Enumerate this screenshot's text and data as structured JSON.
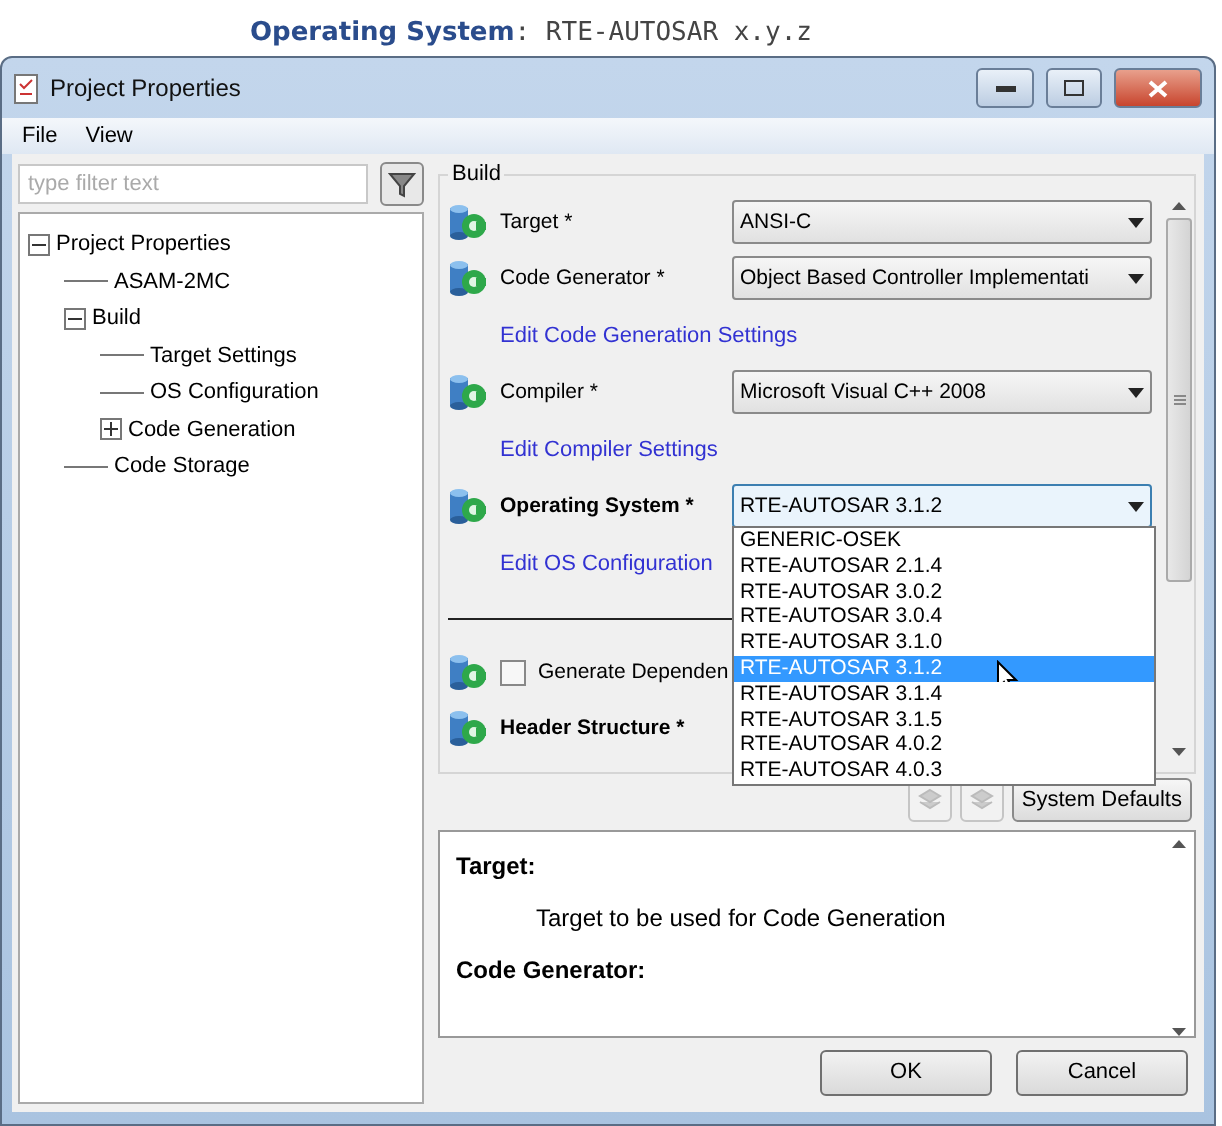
{
  "caption": {
    "label": "Operating System",
    "value": ": RTE-AUTOSAR x.y.z"
  },
  "window": {
    "title": "Project Properties"
  },
  "menu": [
    "File",
    "View"
  ],
  "filter": {
    "placeholder": "type filter text"
  },
  "tree": [
    {
      "label": "Project Properties",
      "expanded": true,
      "children": [
        {
          "label": "ASAM-2MC"
        },
        {
          "label": "Build",
          "expanded": true,
          "children": [
            {
              "label": "Target Settings"
            },
            {
              "label": "OS Configuration"
            },
            {
              "label": "Code Generation",
              "expanded": false
            }
          ]
        },
        {
          "label": "Code Storage"
        }
      ]
    }
  ],
  "build": {
    "title": "Build",
    "fields": [
      {
        "kind": "combo",
        "label": "Target *",
        "value": "ANSI-C",
        "bold": false
      },
      {
        "kind": "combo",
        "label": "Code Generator *",
        "value": "Object Based Controller Implementati",
        "bold": false
      },
      {
        "kind": "link",
        "label": "Edit Code Generation Settings"
      },
      {
        "kind": "combo",
        "label": "Compiler *",
        "value": "Microsoft Visual C++ 2008",
        "bold": false
      },
      {
        "kind": "link",
        "label": "Edit Compiler Settings"
      },
      {
        "kind": "combo",
        "label": "Operating System *",
        "value": "RTE-AUTOSAR 3.1.2",
        "bold": true,
        "open": true,
        "options": [
          {
            "label": "GENERIC-OSEK",
            "selected": false
          },
          {
            "label": "RTE-AUTOSAR 2.1.4",
            "selected": false
          },
          {
            "label": "RTE-AUTOSAR 3.0.2",
            "selected": false
          },
          {
            "label": "RTE-AUTOSAR 3.0.4",
            "selected": false
          },
          {
            "label": "RTE-AUTOSAR 3.1.0",
            "selected": false
          },
          {
            "label": "RTE-AUTOSAR 3.1.2",
            "selected": true
          },
          {
            "label": "RTE-AUTOSAR 3.1.4",
            "selected": false
          },
          {
            "label": "RTE-AUTOSAR 3.1.5",
            "selected": false
          },
          {
            "label": "RTE-AUTOSAR 4.0.2",
            "selected": false
          },
          {
            "label": "RTE-AUTOSAR 4.0.3",
            "selected": false
          }
        ]
      },
      {
        "kind": "link",
        "label": "Edit OS Configuration"
      },
      {
        "kind": "separator"
      },
      {
        "kind": "checkbox",
        "label": "Generate Dependen",
        "checked": false
      },
      {
        "kind": "heading",
        "label": "Header Structure *",
        "bold": true
      }
    ]
  },
  "toolbar": {
    "buttons": [
      {
        "kind": "icon",
        "disabled": true
      },
      {
        "kind": "icon",
        "disabled": true
      },
      {
        "kind": "text",
        "label": "System Defaults",
        "disabled": false
      }
    ]
  },
  "help": [
    {
      "kind": "heading",
      "text": "Target:"
    },
    {
      "kind": "body",
      "text": "Target to be used for Code Generation"
    },
    {
      "kind": "heading",
      "text": "Code Generator:"
    }
  ],
  "buttons": [
    "OK",
    "Cancel"
  ]
}
